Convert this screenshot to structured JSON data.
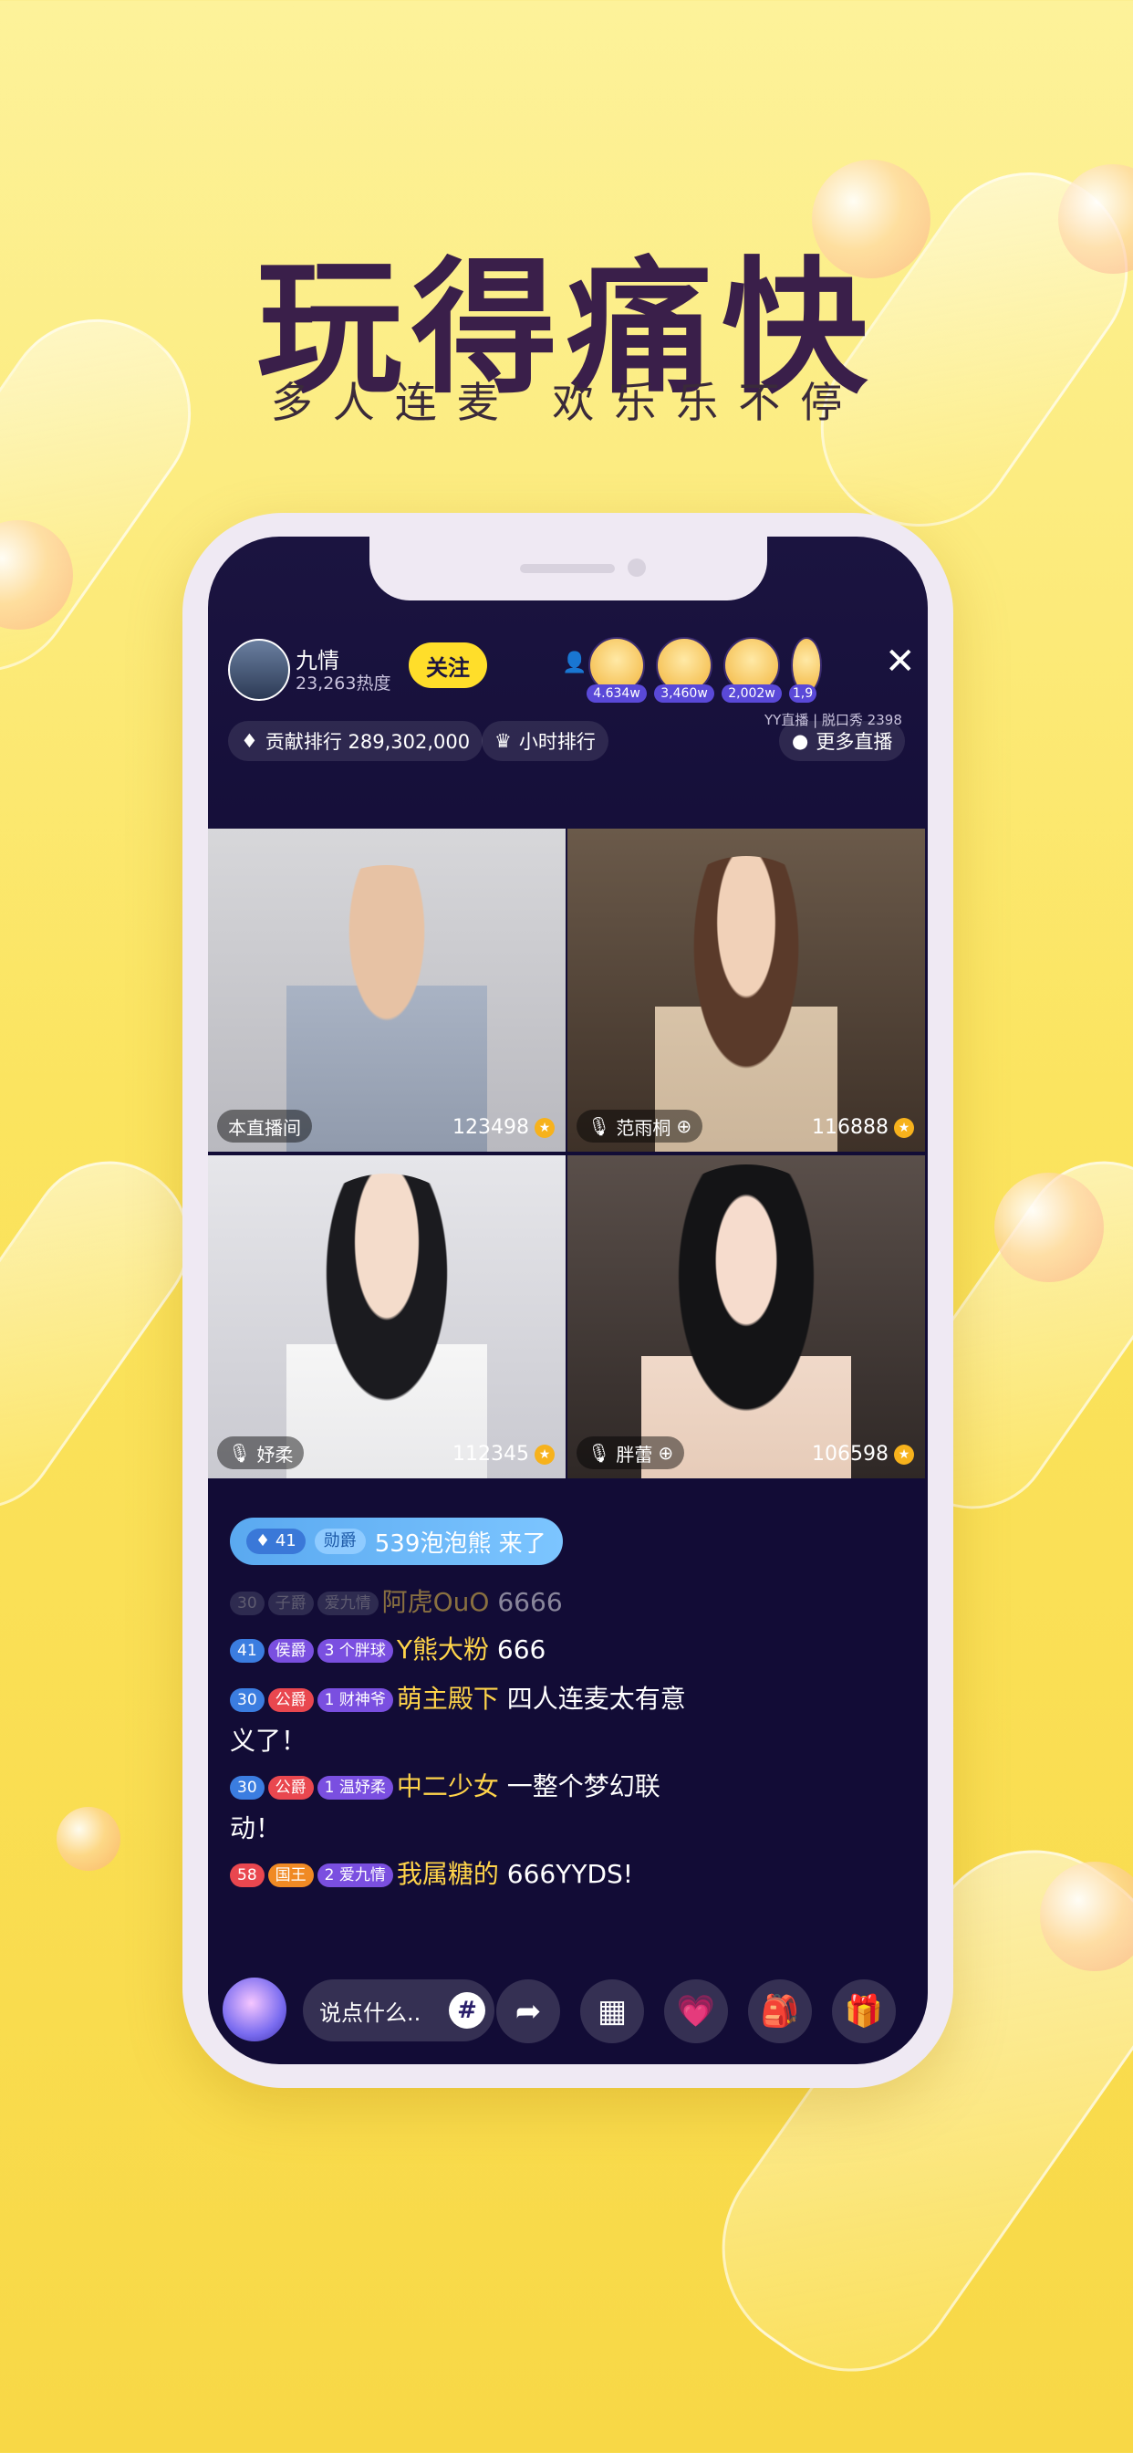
{
  "headline": "玩得痛快",
  "subline": "多人连麦  欢乐乐不停",
  "host": {
    "name": "九情",
    "heat": "23,263热度",
    "follow_label": "关注"
  },
  "viewers": [
    "4.634w",
    "3,460w",
    "2,002w",
    "1,9"
  ],
  "subinfo": "YY直播 | 脱口秀 2398",
  "rank": {
    "contribution": "贡献排行 289,302,000",
    "hourly": "小时排行",
    "more": "更多直播"
  },
  "streams": [
    {
      "tag": "本直播间",
      "score": "123498"
    },
    {
      "tag": "范雨桐",
      "score": "116888"
    },
    {
      "tag": "妤柔",
      "score": "112345"
    },
    {
      "tag": "胖蕾",
      "score": "106598"
    }
  ],
  "chat": {
    "enter": {
      "level": "41",
      "rank": "勋爵",
      "text": "539泡泡熊 来了"
    },
    "messages": [
      {
        "lv": "30",
        "rank": "子爵",
        "fan": "爱九情",
        "name": "阿虎OuO",
        "text": " 6666"
      },
      {
        "lv": "41",
        "rank": "侯爵",
        "fan": "3 个胖球",
        "name": "Y熊大粉",
        "text": " 666"
      },
      {
        "lv": "30",
        "rank": "公爵",
        "fan": "1 财神爷",
        "name": "萌主殿下",
        "text": " 四人连麦太有意义了！"
      },
      {
        "lv": "30",
        "rank": "公爵",
        "fan": "1 温妤柔",
        "name": "中二少女",
        "text": " 一整个梦幻联动！"
      },
      {
        "lv": "58",
        "rank": "国王",
        "fan": "2 爱九情",
        "name": "我属糖的",
        "text": " 666YYDS!"
      }
    ]
  },
  "input_placeholder": "说点什么..",
  "icons": [
    "share-icon",
    "grid-icon",
    "heart-hand-icon",
    "treasure-icon",
    "gift-icon"
  ]
}
